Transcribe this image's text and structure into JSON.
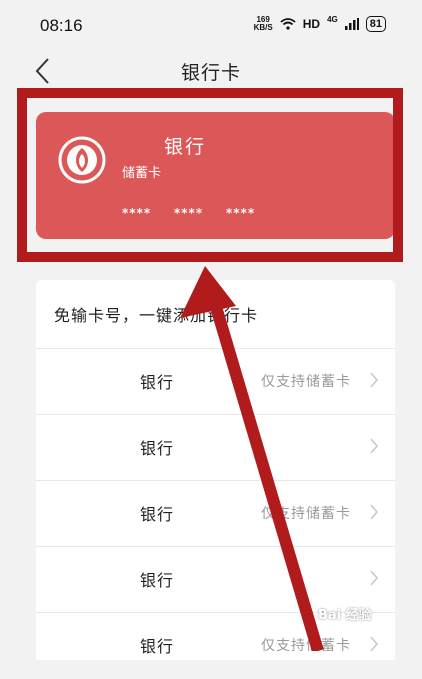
{
  "status_bar": {
    "time": "08:16",
    "speed_value": "169",
    "speed_unit": "KB/S",
    "hd": "HD",
    "net": "4G",
    "battery": "81"
  },
  "nav": {
    "title": "银行卡"
  },
  "card": {
    "bank_name": "银行",
    "card_type": "储蓄卡",
    "number_groups": [
      "****",
      "****",
      "****"
    ],
    "color": "#dc5757"
  },
  "list": {
    "header": "免输卡号，一键添加银行卡",
    "rows": [
      {
        "bank": "银行",
        "note": "仅支持储蓄卡"
      },
      {
        "bank": "银行",
        "note": ""
      },
      {
        "bank": "银行",
        "note": "仅支持储蓄卡"
      },
      {
        "bank": "银行",
        "note": ""
      },
      {
        "bank": "银行",
        "note": "仅支持储蓄卡"
      }
    ]
  },
  "annotation": {
    "color": "#b11b1b"
  },
  "watermark": "Bai 经验"
}
